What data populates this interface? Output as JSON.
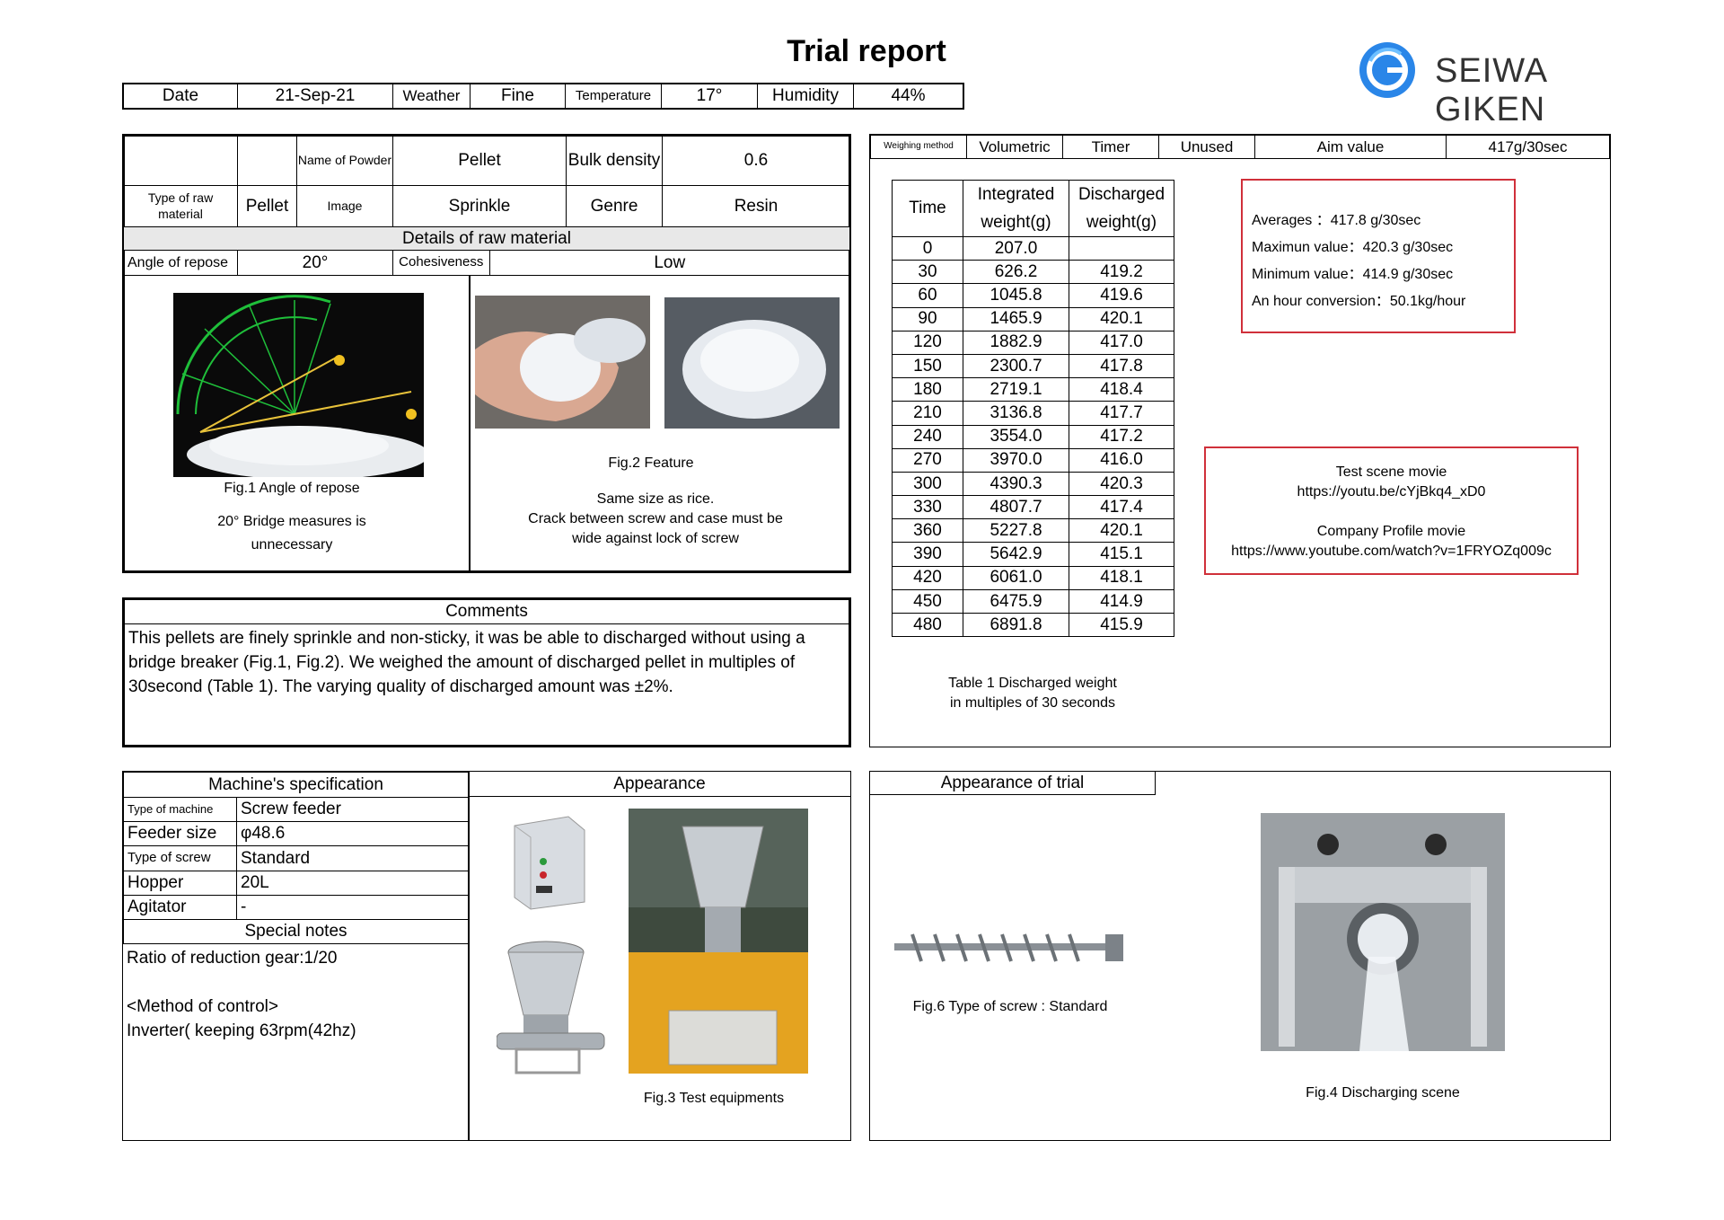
{
  "report": {
    "title": "Trial report"
  },
  "logo": {
    "text": "SEIWA GIKEN",
    "color": "#1a6fd6"
  },
  "header": {
    "date_label": "Date",
    "date": "21-Sep-21",
    "weather_label": "Weather",
    "weather": "Fine",
    "temp_label": "Temperature",
    "temp": "17°",
    "humidity_label": "Humidity",
    "humidity": "44%"
  },
  "material": {
    "type_label": "Type of raw material",
    "type_value": "Pellet",
    "name_label": "Name of Powder",
    "name_value": "Pellet",
    "image_label": "Image",
    "image_value": "Sprinkle",
    "bulk_label": "Bulk density",
    "bulk_value": "0.6",
    "genre_label": "Genre",
    "genre_value": "Resin",
    "details_title": "Details of raw material",
    "angle_label": "Angle of repose",
    "angle_value": "20°",
    "cohesive_label": "Cohesiveness",
    "cohesive_value": "Low",
    "fig1_caption": "Fig.1  Angle of repose",
    "fig1_note1": "20°  Bridge measures is",
    "fig1_note2": "unnecessary",
    "fig2_caption": "Fig.2  Feature",
    "fig2_note1": "Same size as rice.",
    "fig2_note2": "Crack between screw and case must be",
    "fig2_note3": "wide against lock of screw"
  },
  "comments": {
    "title": "Comments",
    "text": "This pellets are finely sprinkle and non-sticky, it was be able to discharged without using a bridge breaker (Fig.1, Fig.2). We weighed the amount of discharged pellet in multiples of 30second (Table 1). The varying quality of discharged amount  was ±2%."
  },
  "weighing": {
    "method_label": "Weighing method",
    "method_value": "Volumetric",
    "timer_label": "Timer",
    "timer_value": "Unused",
    "aim_label": "Aim value",
    "aim_value": "417g/30sec",
    "col_time": "Time",
    "col_integrated": "Integrated weight(g)",
    "col_discharged": "Discharged weight(g)",
    "rows": [
      [
        "0",
        "207.0",
        ""
      ],
      [
        "30",
        "626.2",
        "419.2"
      ],
      [
        "60",
        "1045.8",
        "419.6"
      ],
      [
        "90",
        "1465.9",
        "420.1"
      ],
      [
        "120",
        "1882.9",
        "417.0"
      ],
      [
        "150",
        "2300.7",
        "417.8"
      ],
      [
        "180",
        "2719.1",
        "418.4"
      ],
      [
        "210",
        "3136.8",
        "417.7"
      ],
      [
        "240",
        "3554.0",
        "417.2"
      ],
      [
        "270",
        "3970.0",
        "416.0"
      ],
      [
        "300",
        "4390.3",
        "420.3"
      ],
      [
        "330",
        "4807.7",
        "417.4"
      ],
      [
        "360",
        "5227.8",
        "420.1"
      ],
      [
        "390",
        "5642.9",
        "415.1"
      ],
      [
        "420",
        "6061.0",
        "418.1"
      ],
      [
        "450",
        "6475.9",
        "414.9"
      ],
      [
        "480",
        "6891.8",
        "415.9"
      ]
    ],
    "table_caption1": "Table 1  Discharged weight",
    "table_caption2": "in multiples of 30 seconds",
    "stats": [
      "Averages  ：417.8 g/30sec",
      "Maximun value：420.3 g/30sec",
      "Minimum value：414.9 g/30sec",
      "An hour conversion：50.1kg/hour"
    ],
    "movie_title1": "Test scene movie",
    "movie_url1": "https://youtu.be/cYjBkq4_xD0",
    "movie_title2": "Company Profile movie",
    "movie_url2": "https://www.youtube.com/watch?v=1FRYOZq009c"
  },
  "machine": {
    "title": "Machine's specification",
    "rows": [
      [
        "Type of machine",
        "Screw feeder"
      ],
      [
        "Feeder size",
        "φ48.6"
      ],
      [
        "Type of screw",
        "Standard"
      ],
      [
        "Hopper",
        "20L"
      ],
      [
        "Agitator",
        "-"
      ]
    ],
    "notes_title": "Special notes",
    "note1": "Ratio of reduction gear:1/20",
    "note2": "<Method of control>",
    "note3": "Inverter( keeping 63rpm(42hz)"
  },
  "appearance": {
    "title": "Appearance",
    "fig3_caption": "Fig.3  Test equipments"
  },
  "trial": {
    "title": "Appearance of trial",
    "fig6_caption": "Fig.6  Type of screw : Standard",
    "fig4_caption": "Fig.4  Discharging scene"
  }
}
